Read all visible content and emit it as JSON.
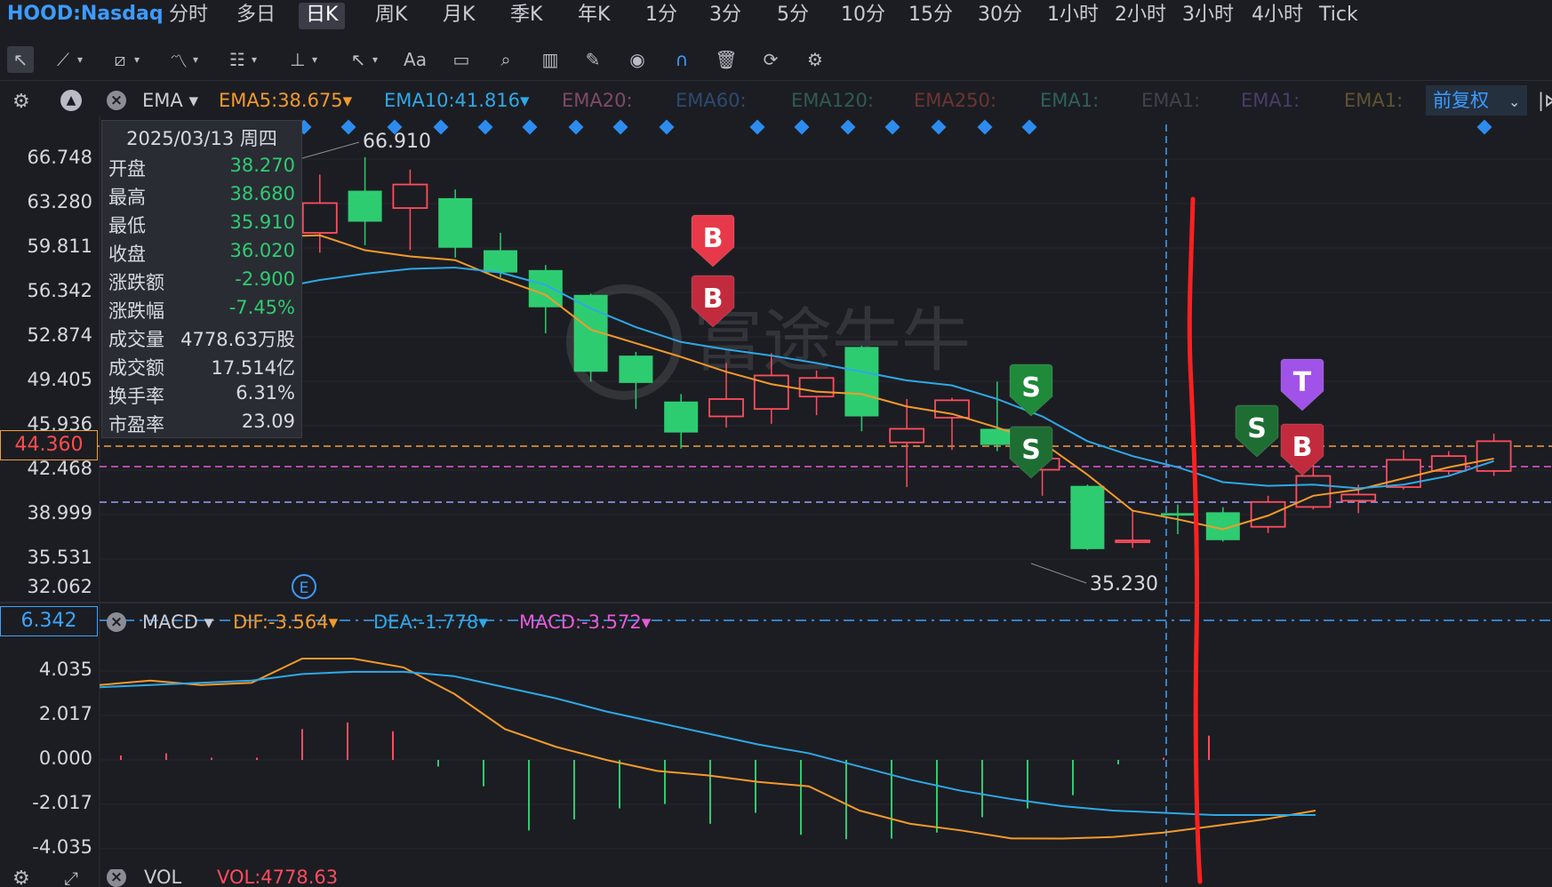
{
  "symbol": "HOOD:Nasdaq",
  "periods": [
    "分时",
    "多日",
    "日K",
    "周K",
    "月K",
    "季K",
    "年K",
    "1分",
    "3分",
    "5分",
    "10分",
    "15分",
    "30分",
    "1小时",
    "2小时",
    "3小时",
    "4小时",
    "Tick"
  ],
  "active_period": "日K",
  "tools": [
    "cursor-icon",
    "line-tool-icon",
    "channel-tool-icon",
    "wave-tool-icon",
    "fib-tool-icon",
    "vertical-tool-icon",
    "arrow-tool-icon",
    "text-tool-icon",
    "comment-icon",
    "search-icon",
    "candle-icon",
    "pencil-icon",
    "eye-icon",
    "magnet-icon",
    "trash-icon",
    "sync-icon",
    "gear-icon"
  ],
  "text_tool_label": "Aa",
  "ema_legend": {
    "indicator": "EMA",
    "items": [
      {
        "label": "EMA5:38.675",
        "color": "#f39a2c"
      },
      {
        "label": "EMA10:41.816",
        "color": "#2ea8e8"
      },
      {
        "label": "EMA20:",
        "color": "#7e4a6a"
      },
      {
        "label": "EMA60:",
        "color": "#2b4a72"
      },
      {
        "label": "EMA120:",
        "color": "#2f5b52"
      },
      {
        "label": "EMA250:",
        "color": "#6b3535"
      },
      {
        "label": "EMA1:",
        "color": "#2f6060"
      },
      {
        "label": "EMA1:",
        "color": "#3f434c"
      },
      {
        "label": "EMA1:",
        "color": "#4a3d6a"
      },
      {
        "label": "EMA1:",
        "color": "#5e5430"
      }
    ],
    "adjust": "前复权"
  },
  "price_axis": [
    "66.748",
    "63.280",
    "59.811",
    "56.342",
    "52.874",
    "49.405",
    "45.936",
    "42.468",
    "38.999",
    "35.531",
    "32.062"
  ],
  "current_price_label": "44.360",
  "annotations": {
    "high": "66.910",
    "low": "35.230"
  },
  "tooltip": {
    "date": "2025/03/13 周四",
    "rows": [
      {
        "k": "开盘",
        "v": "38.270",
        "color": "#2ecc71"
      },
      {
        "k": "最高",
        "v": "38.680",
        "color": "#2ecc71"
      },
      {
        "k": "最低",
        "v": "35.910",
        "color": "#2ecc71"
      },
      {
        "k": "收盘",
        "v": "36.020",
        "color": "#2ecc71"
      },
      {
        "k": "涨跌额",
        "v": "-2.900",
        "color": "#2ecc71"
      },
      {
        "k": "涨跌幅",
        "v": "-7.45%",
        "color": "#2ecc71"
      },
      {
        "k": "成交量",
        "v": "4778.63万股",
        "color": "#d7dae0"
      },
      {
        "k": "成交额",
        "v": "17.514亿",
        "color": "#d7dae0"
      },
      {
        "k": "换手率",
        "v": "6.31%",
        "color": "#d7dae0"
      },
      {
        "k": "市盈率",
        "v": "23.09",
        "color": "#d7dae0"
      }
    ]
  },
  "trade_signals": [
    "B",
    "B",
    "S",
    "S",
    "S",
    "T",
    "B"
  ],
  "event_marker": "E",
  "macd_legend": {
    "indicator": "MACD",
    "dif": "DIF:-3.564",
    "dea": "DEA:-1.778",
    "macd": "MACD:-3.572"
  },
  "macd_axis": [
    "4.035",
    "2.017",
    "0.000",
    "-2.017",
    "-4.035"
  ],
  "macd_cursor_label": "6.342",
  "vol_legend": {
    "indicator": "VOL",
    "vol": "VOL:4778.63"
  },
  "colors": {
    "up": "#ff4d5e",
    "down": "#2ecc71",
    "ema5": "#f39a2c",
    "ema10": "#2ea8e8",
    "accent": "#3d9bff",
    "red_marker": "#ff2020"
  },
  "chart_data": {
    "type": "candlestick",
    "title": "HOOD:Nasdaq 日K",
    "ylim": [
      32.062,
      68.5
    ],
    "candles": [
      {
        "o": 62.0,
        "h": 66.91,
        "l": 60.5,
        "c": 64.5
      },
      {
        "o": 60.8,
        "h": 65.5,
        "l": 59.2,
        "c": 63.2
      },
      {
        "o": 64.2,
        "h": 66.9,
        "l": 59.8,
        "c": 61.7
      },
      {
        "o": 62.8,
        "h": 65.9,
        "l": 59.4,
        "c": 64.7
      },
      {
        "o": 63.6,
        "h": 64.3,
        "l": 58.8,
        "c": 59.6
      },
      {
        "o": 59.4,
        "h": 60.8,
        "l": 57.2,
        "c": 57.6
      },
      {
        "o": 57.8,
        "h": 58.2,
        "l": 52.7,
        "c": 54.8
      },
      {
        "o": 55.8,
        "h": 55.9,
        "l": 48.8,
        "c": 49.6
      },
      {
        "o": 50.9,
        "h": 51.2,
        "l": 46.6,
        "c": 48.7
      },
      {
        "o": 47.2,
        "h": 47.8,
        "l": 43.4,
        "c": 44.7
      },
      {
        "o": 46.0,
        "h": 50.3,
        "l": 45.1,
        "c": 47.4
      },
      {
        "o": 46.6,
        "h": 51.1,
        "l": 45.4,
        "c": 49.3
      },
      {
        "o": 47.6,
        "h": 49.7,
        "l": 46.1,
        "c": 49.1
      },
      {
        "o": 51.6,
        "h": 51.7,
        "l": 44.8,
        "c": 46.0
      },
      {
        "o": 43.9,
        "h": 47.4,
        "l": 40.3,
        "c": 45.0
      },
      {
        "o": 45.9,
        "h": 47.5,
        "l": 43.3,
        "c": 47.3
      },
      {
        "o": 45.0,
        "h": 48.8,
        "l": 43.2,
        "c": 43.7
      },
      {
        "o": 41.7,
        "h": 44.2,
        "l": 39.6,
        "c": 42.6
      },
      {
        "o": 40.4,
        "h": 40.5,
        "l": 35.23,
        "c": 35.3
      },
      {
        "o": 35.9,
        "h": 38.4,
        "l": 35.4,
        "c": 36.0
      },
      {
        "o": 38.2,
        "h": 38.9,
        "l": 36.5,
        "c": 38.0
      },
      {
        "o": 38.27,
        "h": 38.68,
        "l": 35.91,
        "c": 36.02
      },
      {
        "o": 37.1,
        "h": 39.6,
        "l": 36.6,
        "c": 39.1
      },
      {
        "o": 38.7,
        "h": 42.2,
        "l": 38.5,
        "c": 41.2
      },
      {
        "o": 39.2,
        "h": 40.5,
        "l": 38.2,
        "c": 39.7
      },
      {
        "o": 40.3,
        "h": 43.3,
        "l": 40.1,
        "c": 42.5
      },
      {
        "o": 41.6,
        "h": 43.2,
        "l": 41.3,
        "c": 42.8
      },
      {
        "o": 41.6,
        "h": 44.6,
        "l": 41.2,
        "c": 44.0
      }
    ],
    "ema5": [
      60.5,
      60.6,
      59.4,
      58.9,
      58.6,
      57.1,
      55.8,
      53.0,
      51.9,
      50.8,
      49.6,
      48.6,
      48.0,
      47.8,
      46.8,
      46.2,
      45.1,
      43.9,
      41.3,
      38.4,
      37.7,
      36.9,
      38.0,
      39.6,
      40.1,
      41.0,
      41.9,
      42.6
    ],
    "ema10": [
      56.3,
      57.0,
      57.5,
      57.9,
      58.0,
      57.6,
      56.6,
      54.7,
      53.2,
      52.0,
      51.4,
      50.9,
      50.3,
      49.6,
      48.9,
      48.5,
      47.4,
      46.0,
      44.0,
      42.8,
      41.9,
      40.7,
      40.4,
      40.5,
      40.2,
      40.5,
      41.2,
      42.4
    ],
    "macd_dif": [
      3.4,
      3.6,
      3.4,
      3.5,
      4.6,
      4.6,
      4.2,
      3.0,
      1.4,
      0.6,
      0.0,
      -0.5,
      -0.7,
      -1.0,
      -1.2,
      -2.3,
      -2.9,
      -3.2,
      -3.564,
      -3.57,
      -3.5,
      -3.3,
      -3.0,
      -2.7,
      -2.3
    ],
    "macd_dea": [
      3.3,
      3.4,
      3.5,
      3.6,
      3.9,
      4.0,
      4.0,
      3.8,
      3.3,
      2.8,
      2.2,
      1.7,
      1.2,
      0.7,
      0.3,
      -0.3,
      -0.9,
      -1.4,
      -1.778,
      -2.1,
      -2.3,
      -2.4,
      -2.5,
      -2.5,
      -2.5
    ],
    "macd_hist": [
      0.2,
      0.3,
      0.1,
      0.1,
      1.4,
      1.7,
      1.3,
      -0.3,
      -1.2,
      -3.2,
      -2.7,
      -2.2,
      -2.0,
      -2.9,
      -2.4,
      -3.4,
      -3.6,
      -3.572,
      -3.3,
      -2.6,
      -2.2,
      -1.6,
      -0.2,
      0.1,
      1.1
    ]
  }
}
